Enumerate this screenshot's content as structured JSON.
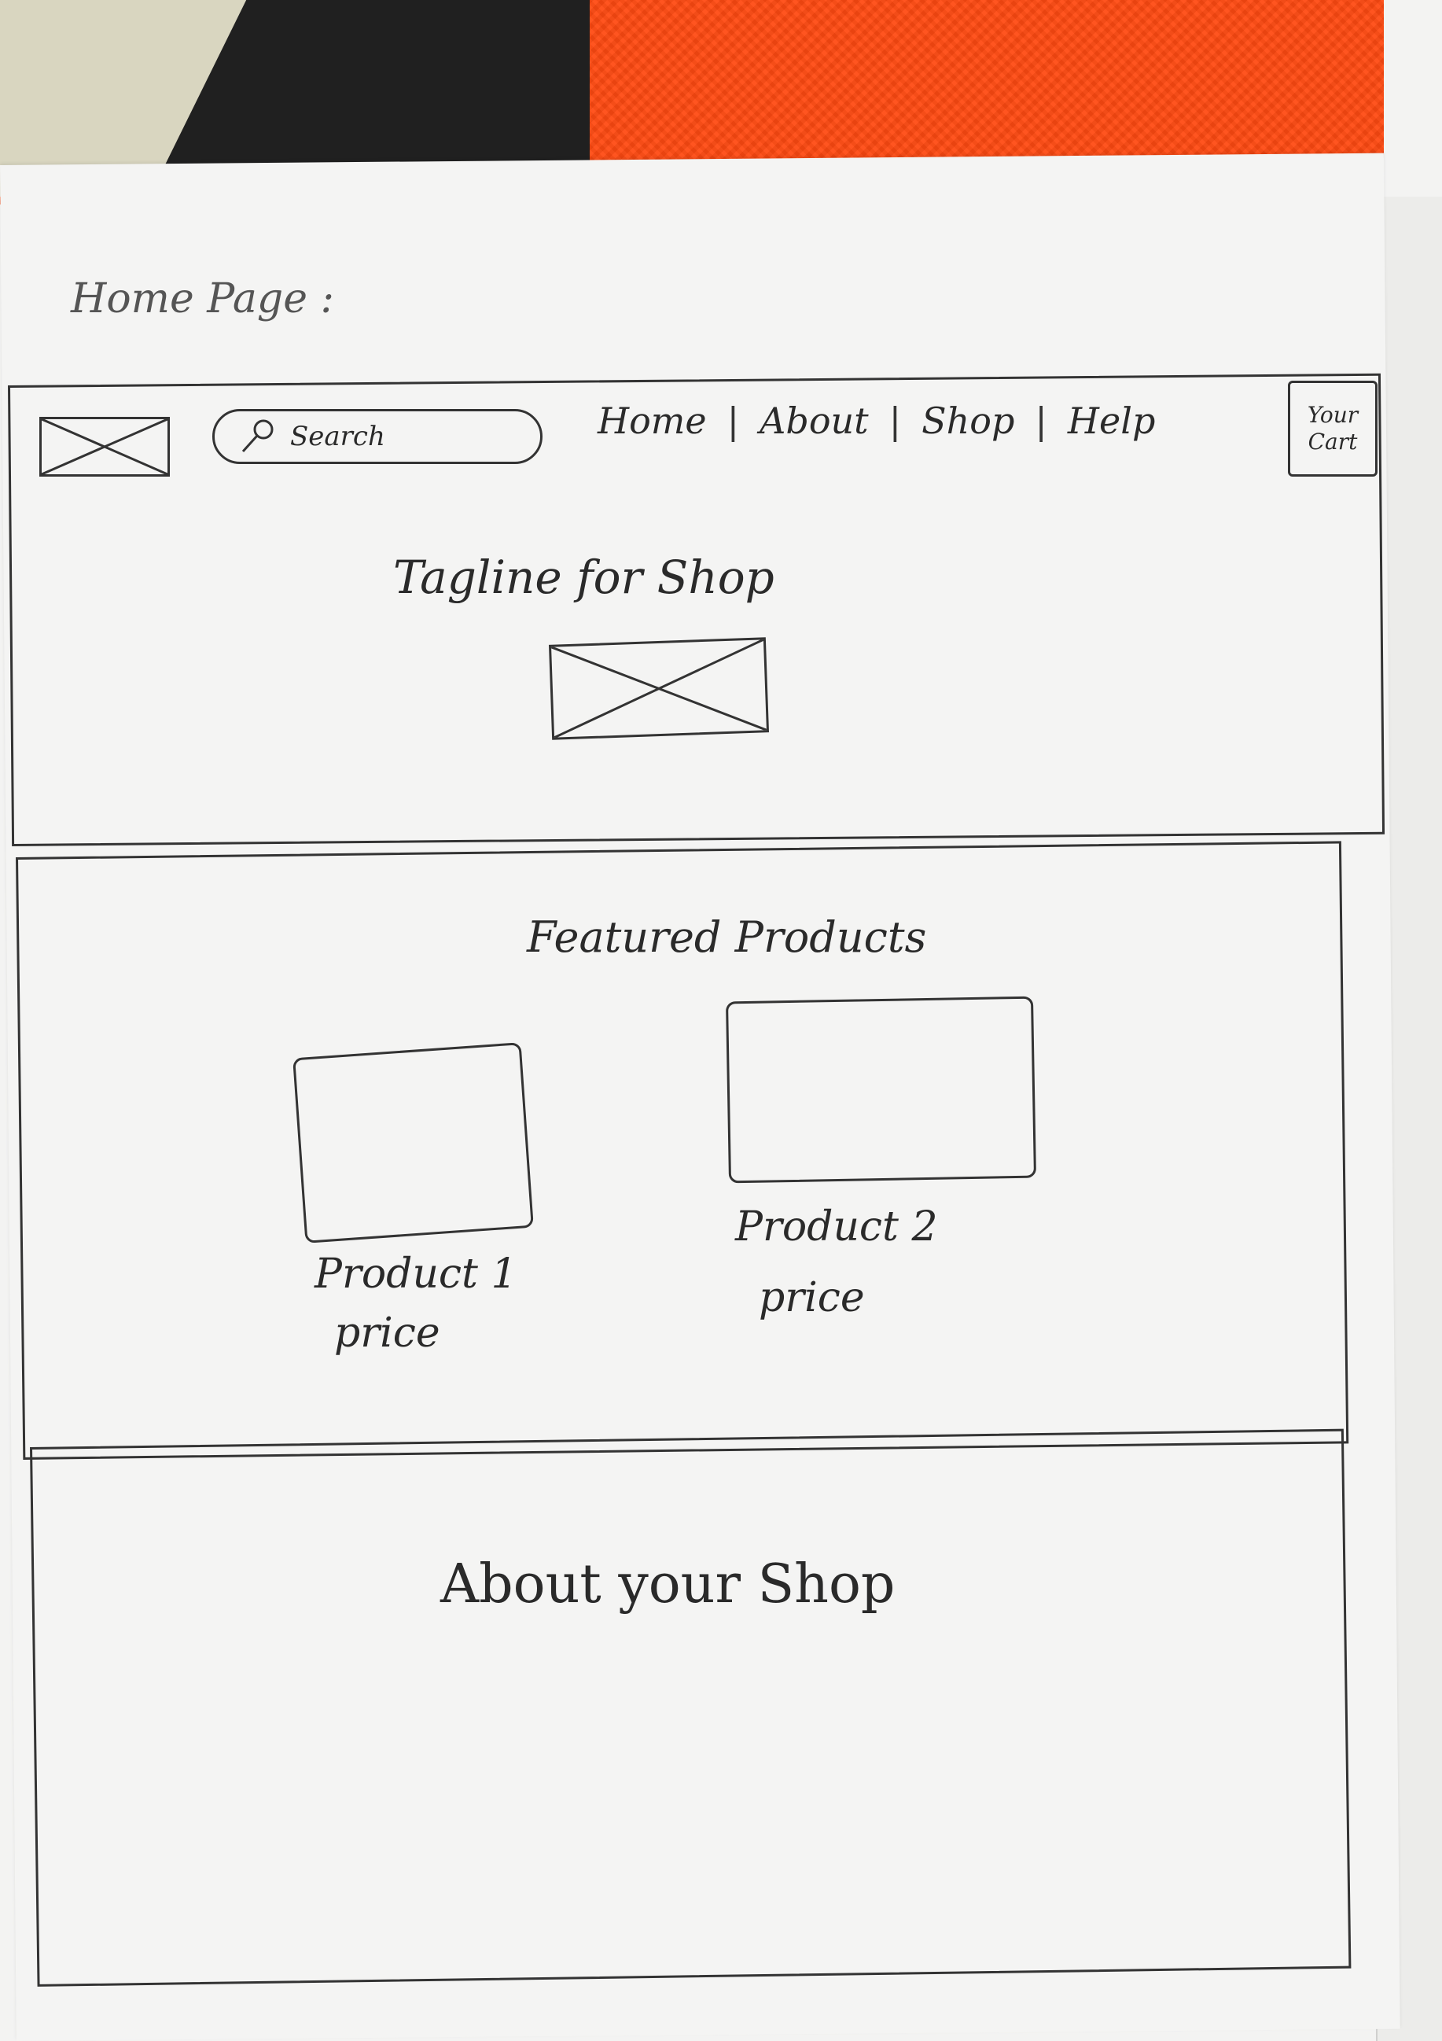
{
  "sketch": {
    "page_title": "Home Page :",
    "header": {
      "search_label": "Search",
      "nav": [
        "Home",
        "About",
        "Shop",
        "Help"
      ],
      "cart_label": "Your Cart",
      "tagline": "Tagline for Shop"
    },
    "featured": {
      "title": "Featured Products",
      "products": [
        {
          "name": "Product 1",
          "price": "price"
        },
        {
          "name": "Product 2",
          "price": "price"
        }
      ]
    },
    "about": {
      "title": "About your Shop"
    }
  }
}
